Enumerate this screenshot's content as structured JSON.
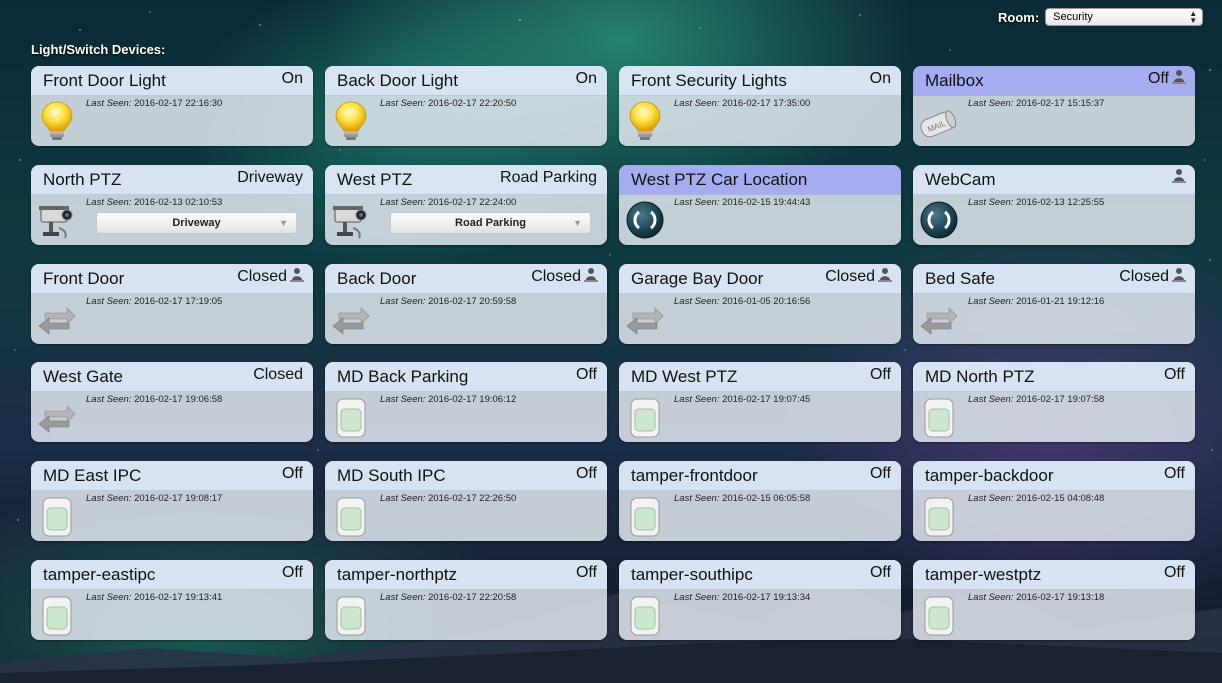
{
  "room": {
    "label": "Room:",
    "value": "Security"
  },
  "section_heading": "Light/Switch Devices:",
  "last_seen_label": "Last Seen:",
  "colors": {
    "active_header": "#a5acef",
    "tile_bg": "#e1e8f0"
  },
  "devices": [
    {
      "name": "Front Door Light",
      "state": "On",
      "last_seen": "2016-02-17 22:16:30",
      "icon": "lightbulb-icon"
    },
    {
      "name": "Back Door Light",
      "state": "On",
      "last_seen": "2016-02-17 22:20:50",
      "icon": "lightbulb-icon"
    },
    {
      "name": "Front Security Lights",
      "state": "On",
      "last_seen": "2016-02-17 17:35:00",
      "icon": "lightbulb-icon"
    },
    {
      "name": "Mailbox",
      "state": "Off",
      "last_seen": "2016-02-17 15:15:37",
      "icon": "mailbox-icon",
      "active": true,
      "person": true
    },
    {
      "name": "North PTZ",
      "state": "Driveway",
      "last_seen": "2016-02-13 02:10:53",
      "icon": "camera-icon",
      "select": "Driveway"
    },
    {
      "name": "West PTZ",
      "state": "Road Parking",
      "last_seen": "2016-02-17 22:24:00",
      "icon": "camera-icon",
      "select": "Road Parking"
    },
    {
      "name": "West PTZ Car Location",
      "state": "",
      "last_seen": "2016-02-15 19:44:43",
      "icon": "refresh-icon",
      "active": true
    },
    {
      "name": "WebCam",
      "state": "",
      "last_seen": "2016-02-13 12:25:55",
      "icon": "refresh-icon",
      "person": true
    },
    {
      "name": "Front Door",
      "state": "Closed",
      "last_seen": "2016-02-17 17:19:05",
      "icon": "door-arrows-icon",
      "person": true
    },
    {
      "name": "Back Door",
      "state": "Closed",
      "last_seen": "2016-02-17 20:59:58",
      "icon": "door-arrows-icon",
      "person": true
    },
    {
      "name": "Garage Bay Door",
      "state": "Closed",
      "last_seen": "2016-01-05 20:16:56",
      "icon": "door-arrows-icon",
      "person": true
    },
    {
      "name": "Bed Safe",
      "state": "Closed",
      "last_seen": "2016-01-21 19:12:16",
      "icon": "door-arrows-icon",
      "person": true
    },
    {
      "name": "West Gate",
      "state": "Closed",
      "last_seen": "2016-02-17 19:06:58",
      "icon": "door-arrows-icon"
    },
    {
      "name": "MD Back Parking",
      "state": "Off",
      "last_seen": "2016-02-17 19:06:12",
      "icon": "motion-sensor-icon"
    },
    {
      "name": "MD West PTZ",
      "state": "Off",
      "last_seen": "2016-02-17 19:07:45",
      "icon": "motion-sensor-icon"
    },
    {
      "name": "MD North PTZ",
      "state": "Off",
      "last_seen": "2016-02-17 19:07:58",
      "icon": "motion-sensor-icon"
    },
    {
      "name": "MD East IPC",
      "state": "Off",
      "last_seen": "2016-02-17 19:08:17",
      "icon": "motion-sensor-icon"
    },
    {
      "name": "MD South IPC",
      "state": "Off",
      "last_seen": "2016-02-17 22:26:50",
      "icon": "motion-sensor-icon"
    },
    {
      "name": "tamper-frontdoor",
      "state": "Off",
      "last_seen": "2016-02-15 06:05:58",
      "icon": "motion-sensor-icon"
    },
    {
      "name": "tamper-backdoor",
      "state": "Off",
      "last_seen": "2016-02-15 04:08:48",
      "icon": "motion-sensor-icon"
    },
    {
      "name": "tamper-eastipc",
      "state": "Off",
      "last_seen": "2016-02-17 19:13:41",
      "icon": "motion-sensor-icon"
    },
    {
      "name": "tamper-northptz",
      "state": "Off",
      "last_seen": "2016-02-17 22:20:58",
      "icon": "motion-sensor-icon"
    },
    {
      "name": "tamper-southipc",
      "state": "Off",
      "last_seen": "2016-02-17 19:13:34",
      "icon": "motion-sensor-icon"
    },
    {
      "name": "tamper-westptz",
      "state": "Off",
      "last_seen": "2016-02-17 19:13:18",
      "icon": "motion-sensor-icon"
    }
  ]
}
